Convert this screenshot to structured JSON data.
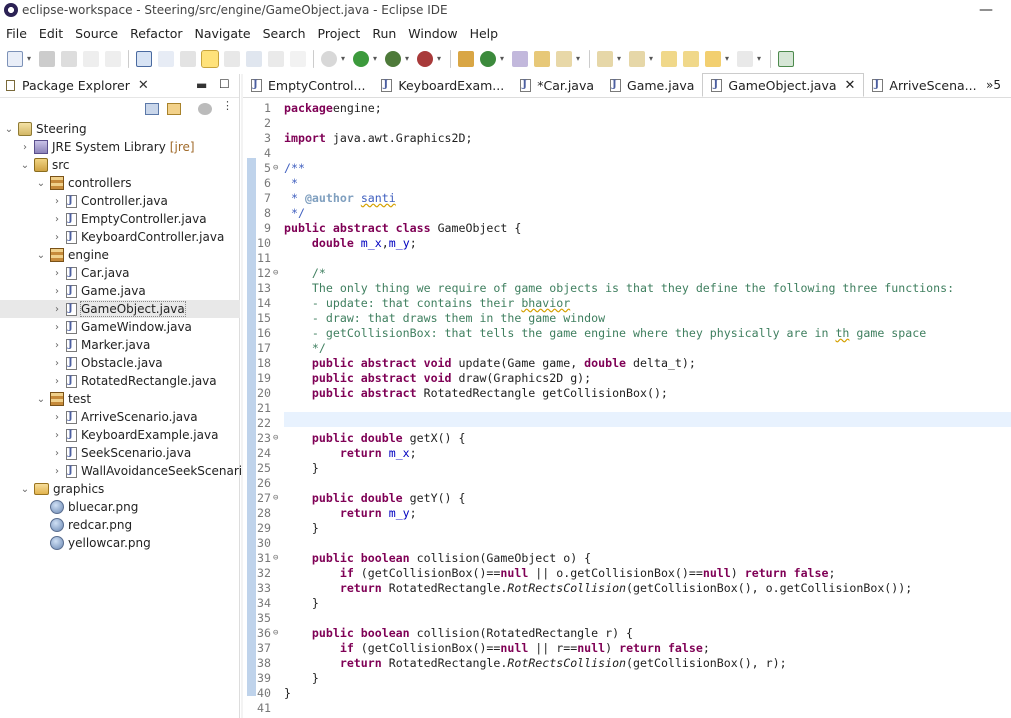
{
  "window": {
    "title": "eclipse-workspace - Steering/src/engine/GameObject.java - Eclipse IDE",
    "minimize": "—"
  },
  "menu": [
    "File",
    "Edit",
    "Source",
    "Refactor",
    "Navigate",
    "Search",
    "Project",
    "Run",
    "Window",
    "Help"
  ],
  "package_explorer": {
    "title": "Package Explorer",
    "tree": [
      {
        "label": "Steering",
        "icon": "project-icon",
        "level": 0,
        "expanded": true
      },
      {
        "label": "JRE System Library",
        "suffix": "[jre]",
        "icon": "library-icon",
        "level": 1,
        "expanded": false
      },
      {
        "label": "src",
        "icon": "source-folder-icon",
        "level": 1,
        "expanded": true
      },
      {
        "label": "controllers",
        "icon": "package-icon",
        "level": 2,
        "expanded": true
      },
      {
        "label": "Controller.java",
        "icon": "java-file-icon",
        "level": 3,
        "expanded": false
      },
      {
        "label": "EmptyController.java",
        "icon": "java-file-icon",
        "level": 3,
        "expanded": false
      },
      {
        "label": "KeyboardController.java",
        "icon": "java-file-icon",
        "level": 3,
        "expanded": false
      },
      {
        "label": "engine",
        "icon": "package-icon",
        "level": 2,
        "expanded": true
      },
      {
        "label": "Car.java",
        "icon": "java-file-icon",
        "level": 3,
        "expanded": false
      },
      {
        "label": "Game.java",
        "icon": "java-file-icon",
        "level": 3,
        "expanded": false
      },
      {
        "label": "GameObject.java",
        "icon": "java-file-icon",
        "level": 3,
        "expanded": false,
        "selected": true
      },
      {
        "label": "GameWindow.java",
        "icon": "java-file-icon",
        "level": 3,
        "expanded": false
      },
      {
        "label": "Marker.java",
        "icon": "java-file-icon",
        "level": 3,
        "expanded": false
      },
      {
        "label": "Obstacle.java",
        "icon": "java-file-icon",
        "level": 3,
        "expanded": false
      },
      {
        "label": "RotatedRectangle.java",
        "icon": "java-file-icon",
        "level": 3,
        "expanded": false
      },
      {
        "label": "test",
        "icon": "package-icon",
        "level": 2,
        "expanded": true
      },
      {
        "label": "ArriveScenario.java",
        "icon": "java-file-icon",
        "level": 3,
        "expanded": false
      },
      {
        "label": "KeyboardExample.java",
        "icon": "java-file-icon",
        "level": 3,
        "expanded": false
      },
      {
        "label": "SeekScenario.java",
        "icon": "java-file-icon",
        "level": 3,
        "expanded": false
      },
      {
        "label": "WallAvoidanceSeekScenario.",
        "icon": "java-file-icon",
        "level": 3,
        "expanded": false
      },
      {
        "label": "graphics",
        "icon": "folder-icon",
        "level": 1,
        "expanded": true
      },
      {
        "label": "bluecar.png",
        "icon": "image-file-icon",
        "level": 2,
        "leaf": true
      },
      {
        "label": "redcar.png",
        "icon": "image-file-icon",
        "level": 2,
        "leaf": true
      },
      {
        "label": "yellowcar.png",
        "icon": "image-file-icon",
        "level": 2,
        "leaf": true
      }
    ]
  },
  "editor_tabs": [
    {
      "label": "EmptyControl..."
    },
    {
      "label": "KeyboardExam..."
    },
    {
      "label": "*Car.java"
    },
    {
      "label": "Game.java"
    },
    {
      "label": "GameObject.java",
      "active": true
    },
    {
      "label": "ArriveScena..."
    }
  ],
  "tabs_overflow": "»5",
  "current_line": 22,
  "code_lines": [
    [
      [
        "k",
        "package"
      ],
      [
        "",
        "engine;"
      ]
    ],
    [],
    [
      [
        "k",
        "import"
      ],
      [
        "",
        " java.awt.Graphics2D;"
      ]
    ],
    [],
    [
      [
        "jd",
        "/**"
      ]
    ],
    [
      [
        "jd",
        " *"
      ]
    ],
    [
      [
        "jd",
        " * "
      ],
      [
        "tag",
        "@author"
      ],
      [
        "jd",
        " "
      ],
      [
        "jdsq",
        "santi"
      ]
    ],
    [
      [
        "jd",
        " */"
      ]
    ],
    [
      [
        "k",
        "public abstract class"
      ],
      [
        "",
        " GameObject {"
      ]
    ],
    [
      [
        "",
        "    "
      ],
      [
        "k",
        "double"
      ],
      [
        "",
        " "
      ],
      [
        "f",
        "m_x"
      ],
      [
        ",",
        ","
      ],
      [
        "f",
        "m_y"
      ],
      [
        "",
        ";"
      ]
    ],
    [],
    [
      [
        "cm",
        "    /*"
      ]
    ],
    [
      [
        "cm",
        "    The only thing we require of game objects is that they define the following three functions:"
      ]
    ],
    [
      [
        "cm",
        "    - update: that contains their "
      ],
      [
        "cmsq",
        "bhavior"
      ]
    ],
    [
      [
        "cm",
        "    - draw: that draws them in the game window"
      ]
    ],
    [
      [
        "cm",
        "    - getCollisionBox: that tells the game engine where they physically are in "
      ],
      [
        "cmsq",
        "th"
      ],
      [
        "cm",
        " game space"
      ]
    ],
    [
      [
        "cm",
        "    */"
      ]
    ],
    [
      [
        "",
        "    "
      ],
      [
        "k",
        "public abstract void"
      ],
      [
        "",
        " update(Game game, "
      ],
      [
        "k",
        "double"
      ],
      [
        "",
        " delta_t);"
      ]
    ],
    [
      [
        "",
        "    "
      ],
      [
        "k",
        "public abstract void"
      ],
      [
        "",
        " draw(Graphics2D g);"
      ]
    ],
    [
      [
        "",
        "    "
      ],
      [
        "k",
        "public abstract"
      ],
      [
        "",
        " RotatedRectangle getCollisionBox();"
      ]
    ],
    [],
    [],
    [
      [
        "",
        "    "
      ],
      [
        "k",
        "public double"
      ],
      [
        "",
        " getX() {"
      ]
    ],
    [
      [
        "",
        "        "
      ],
      [
        "k",
        "return"
      ],
      [
        "",
        " "
      ],
      [
        "f",
        "m_x"
      ],
      [
        "",
        ";"
      ]
    ],
    [
      [
        "",
        "    }"
      ]
    ],
    [],
    [
      [
        "",
        "    "
      ],
      [
        "k",
        "public double"
      ],
      [
        "",
        " getY() {"
      ]
    ],
    [
      [
        "",
        "        "
      ],
      [
        "k",
        "return"
      ],
      [
        "",
        " "
      ],
      [
        "f",
        "m_y"
      ],
      [
        "",
        ";"
      ]
    ],
    [
      [
        "",
        "    }"
      ]
    ],
    [],
    [
      [
        "",
        "    "
      ],
      [
        "k",
        "public boolean"
      ],
      [
        "",
        " collision(GameObject o) {"
      ]
    ],
    [
      [
        "",
        "        "
      ],
      [
        "k",
        "if"
      ],
      [
        "",
        " (getCollisionBox()=="
      ],
      [
        "k",
        "null"
      ],
      [
        "",
        " || o.getCollisionBox()=="
      ],
      [
        "k",
        "null"
      ],
      [
        "",
        ") "
      ],
      [
        "k",
        "return false"
      ],
      [
        "",
        ";"
      ]
    ],
    [
      [
        "",
        "        "
      ],
      [
        "k",
        "return"
      ],
      [
        "",
        " RotatedRectangle."
      ],
      [
        "it",
        "RotRectsCollision"
      ],
      [
        "",
        "(getCollisionBox(), o.getCollisionBox());"
      ]
    ],
    [
      [
        "",
        "    }"
      ]
    ],
    [],
    [
      [
        "",
        "    "
      ],
      [
        "k",
        "public boolean"
      ],
      [
        "",
        " collision(RotatedRectangle r) {"
      ]
    ],
    [
      [
        "",
        "        "
      ],
      [
        "k",
        "if"
      ],
      [
        "",
        " (getCollisionBox()=="
      ],
      [
        "k",
        "null"
      ],
      [
        "",
        " || r=="
      ],
      [
        "k",
        "null"
      ],
      [
        "",
        ") "
      ],
      [
        "k",
        "return false"
      ],
      [
        "",
        ";"
      ]
    ],
    [
      [
        "",
        "        "
      ],
      [
        "k",
        "return"
      ],
      [
        "",
        " RotatedRectangle."
      ],
      [
        "it",
        "RotRectsCollision"
      ],
      [
        "",
        "(getCollisionBox(), r);"
      ]
    ],
    [
      [
        "",
        "    }"
      ]
    ],
    [
      [
        "",
        "}"
      ]
    ],
    []
  ],
  "fold_lines": [
    5,
    12,
    23,
    27,
    31,
    36
  ],
  "colors": {
    "keyword": "#7f0055",
    "comment": "#3f7f5f",
    "javadoc": "#3f5fbf",
    "field": "#0000c0",
    "current_line": "#e8f2fe"
  }
}
